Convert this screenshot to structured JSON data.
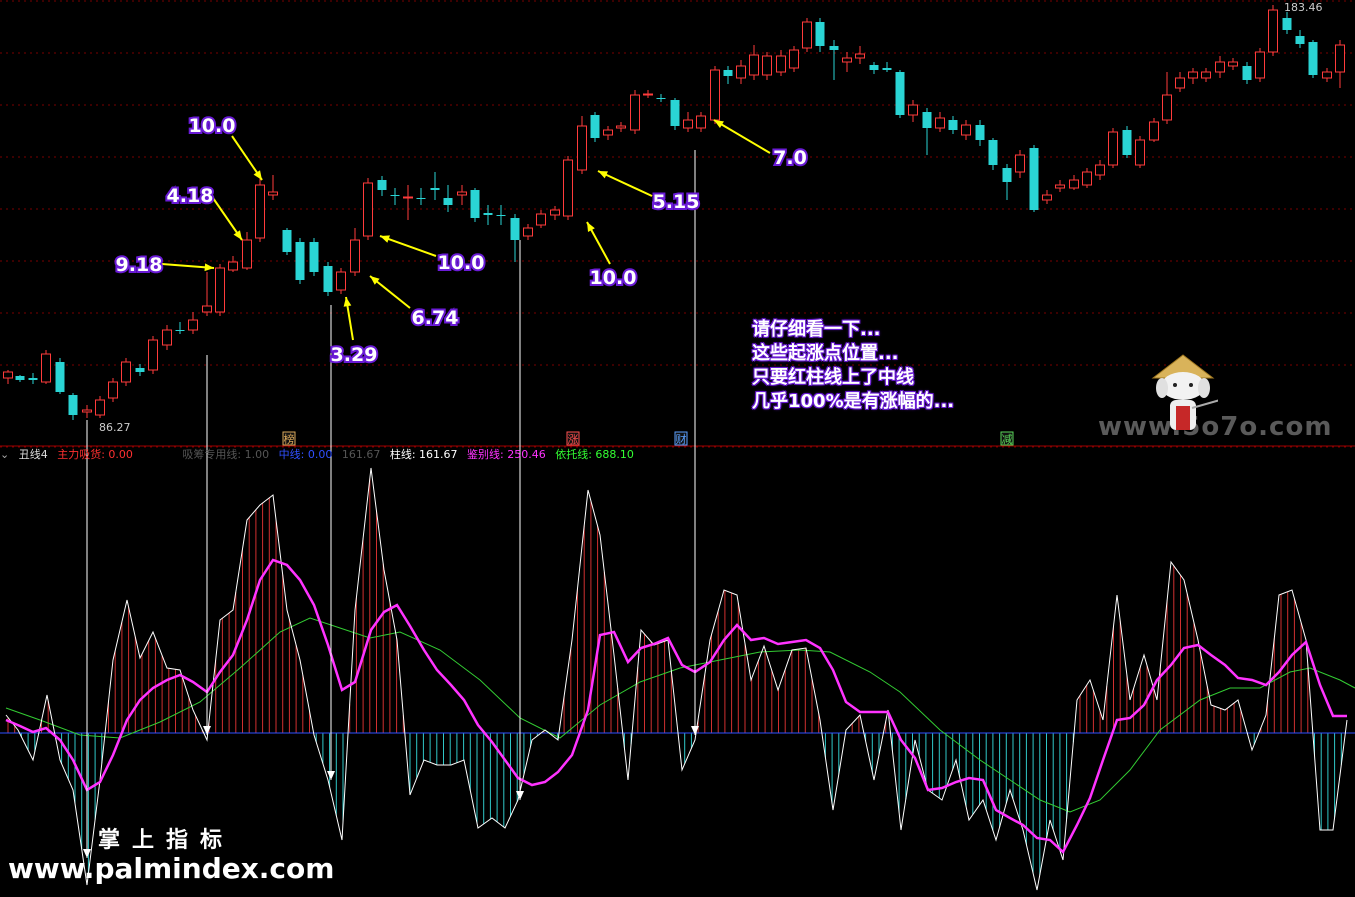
{
  "chart_data": [
    {
      "type": "candlestick",
      "price_high_label": "183.46",
      "price_low_label": "86.27",
      "annotations": [
        "9.18",
        "4.18",
        "10.0",
        "3.29",
        "6.74",
        "10.0",
        "10.0",
        "5.15",
        "7.0"
      ],
      "event_tags": [
        "榜",
        "涨",
        "财",
        "减"
      ],
      "note_lines": [
        "请仔细看一下...",
        "这些起涨点位置...",
        "只要红柱线上了中线",
        "几乎100%是有涨幅的..."
      ]
    },
    {
      "type": "line",
      "indicator_name": "丑线4",
      "legend": [
        {
          "label": "主力吸货: 0.00",
          "color": "#ff3030"
        },
        {
          "label": "吸筹专用线: 1.00",
          "color": "#555555"
        },
        {
          "label": "中线: 0.00",
          "color": "#3050ff"
        },
        {
          "label": "161.67",
          "color": "#555555"
        },
        {
          "label": "柱线: 161.67",
          "color": "#ffffff"
        },
        {
          "label": "鉴别线: 250.46",
          "color": "#ff33ff"
        },
        {
          "label": "依托线: 688.10",
          "color": "#33ff33"
        }
      ]
    }
  ],
  "watermarks": {
    "site": "www.5o7o.com",
    "cn": "掌上指标",
    "url": "www.palmindex.com"
  },
  "colors": {
    "up": "#ff3b3b",
    "down": "#2ad4d4",
    "grid": "#7a0000",
    "arrow": "#ffff00",
    "label_bg": "#6a1bd6",
    "zero": "#3050ff",
    "main": "#ff33ff",
    "slow": "#33cc33"
  }
}
